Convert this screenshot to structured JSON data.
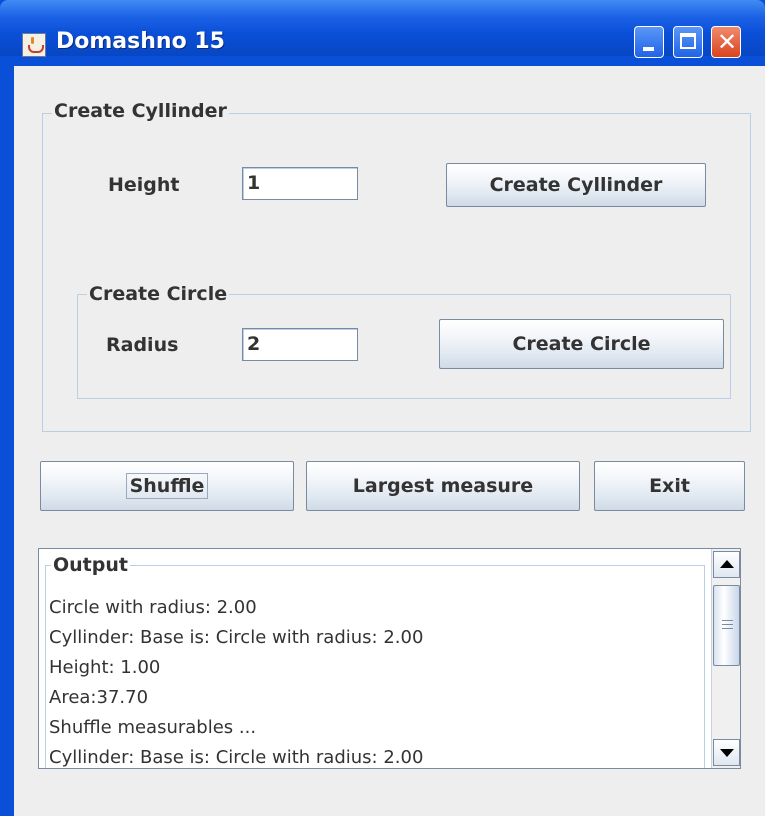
{
  "window": {
    "title": "Domashno 15",
    "icon": "java-cup-icon",
    "controls": {
      "minimize": "minimize-icon",
      "maximize": "maximize-icon",
      "close": "close-icon",
      "close_glyph": "✕"
    }
  },
  "cylinder_group": {
    "title": "Create Cyllinder",
    "height_label": "Height",
    "height_value": "1",
    "create_button": "Create Cyllinder"
  },
  "circle_group": {
    "title": "Create Circle",
    "radius_label": "Radius",
    "radius_value": "2",
    "create_button": "Create Circle"
  },
  "actions": {
    "shuffle": "Shuffle",
    "largest": "Largest measure",
    "exit": "Exit"
  },
  "output": {
    "title": "Output",
    "lines": [
      "Circle with radius: 2.00",
      "Cyllinder: Base is: Circle with radius: 2.00",
      "Height: 1.00",
      "Area:37.70",
      "Shuffle measurables ...",
      "Cyllinder: Base is: Circle with radius: 2.00"
    ]
  },
  "colors": {
    "titlebar": "#0a4fd8",
    "panel_bg": "#eeeeee",
    "border": "#b8cfe5",
    "close_button": "#d9431d"
  }
}
